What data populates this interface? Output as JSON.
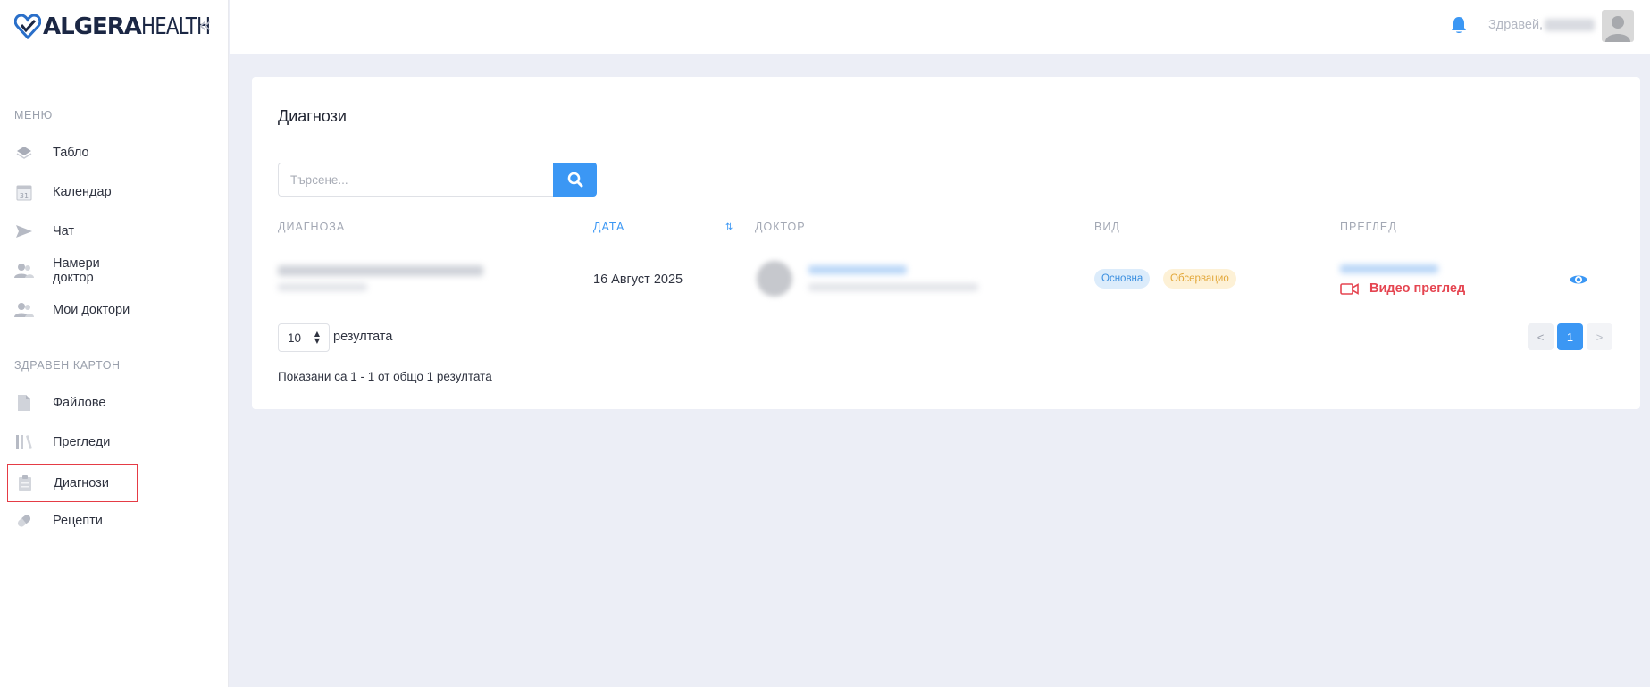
{
  "brand": {
    "bold": "ALGERA",
    "light": "HEALTH",
    "colors": {
      "accent": "#3b97f4",
      "navy": "#1b2744",
      "danger": "#e54551"
    }
  },
  "sidebar": {
    "collapse_icon": "double-chevron-left-icon",
    "menu_title": "МЕНЮ",
    "menu_items": [
      {
        "label": "Табло",
        "icon": "layers-icon"
      },
      {
        "label": "Календар",
        "icon": "calendar-icon"
      },
      {
        "label": "Чат",
        "icon": "send-icon"
      },
      {
        "label": "Намери доктор",
        "icon": "users-icon"
      },
      {
        "label": "Мои доктори",
        "icon": "users-icon"
      }
    ],
    "health_title": "ЗДРАВЕН КАРТОН",
    "health_items": [
      {
        "label": "Файлове",
        "icon": "file-icon"
      },
      {
        "label": "Прегледи",
        "icon": "books-icon"
      },
      {
        "label": "Диагнози",
        "icon": "clipboard-icon",
        "active": true
      },
      {
        "label": "Рецепти",
        "icon": "pill-icon"
      }
    ]
  },
  "topbar": {
    "greeting": "Здравей,",
    "bell_icon": "bell-icon",
    "avatar_icon": "user-avatar-icon"
  },
  "page": {
    "title": "Диагнози",
    "search": {
      "placeholder": "Търсене...",
      "value": ""
    },
    "table": {
      "columns": [
        "ДИАГНОЗА",
        "ДАТА",
        "ДОКТОР",
        "ВИД",
        "ПРЕГЛЕД"
      ],
      "sorted_column": "ДАТА",
      "rows": [
        {
          "date": "16 Август 2025",
          "types": [
            "Основна",
            "Обсервацио"
          ],
          "exam_link": "Видео преглед"
        }
      ]
    },
    "pagination": {
      "page_size": "10",
      "page_size_label": "резултата",
      "summary": "Показани са 1 - 1 от общо 1 резултата",
      "prev": "<",
      "current": "1",
      "next": ">"
    }
  }
}
